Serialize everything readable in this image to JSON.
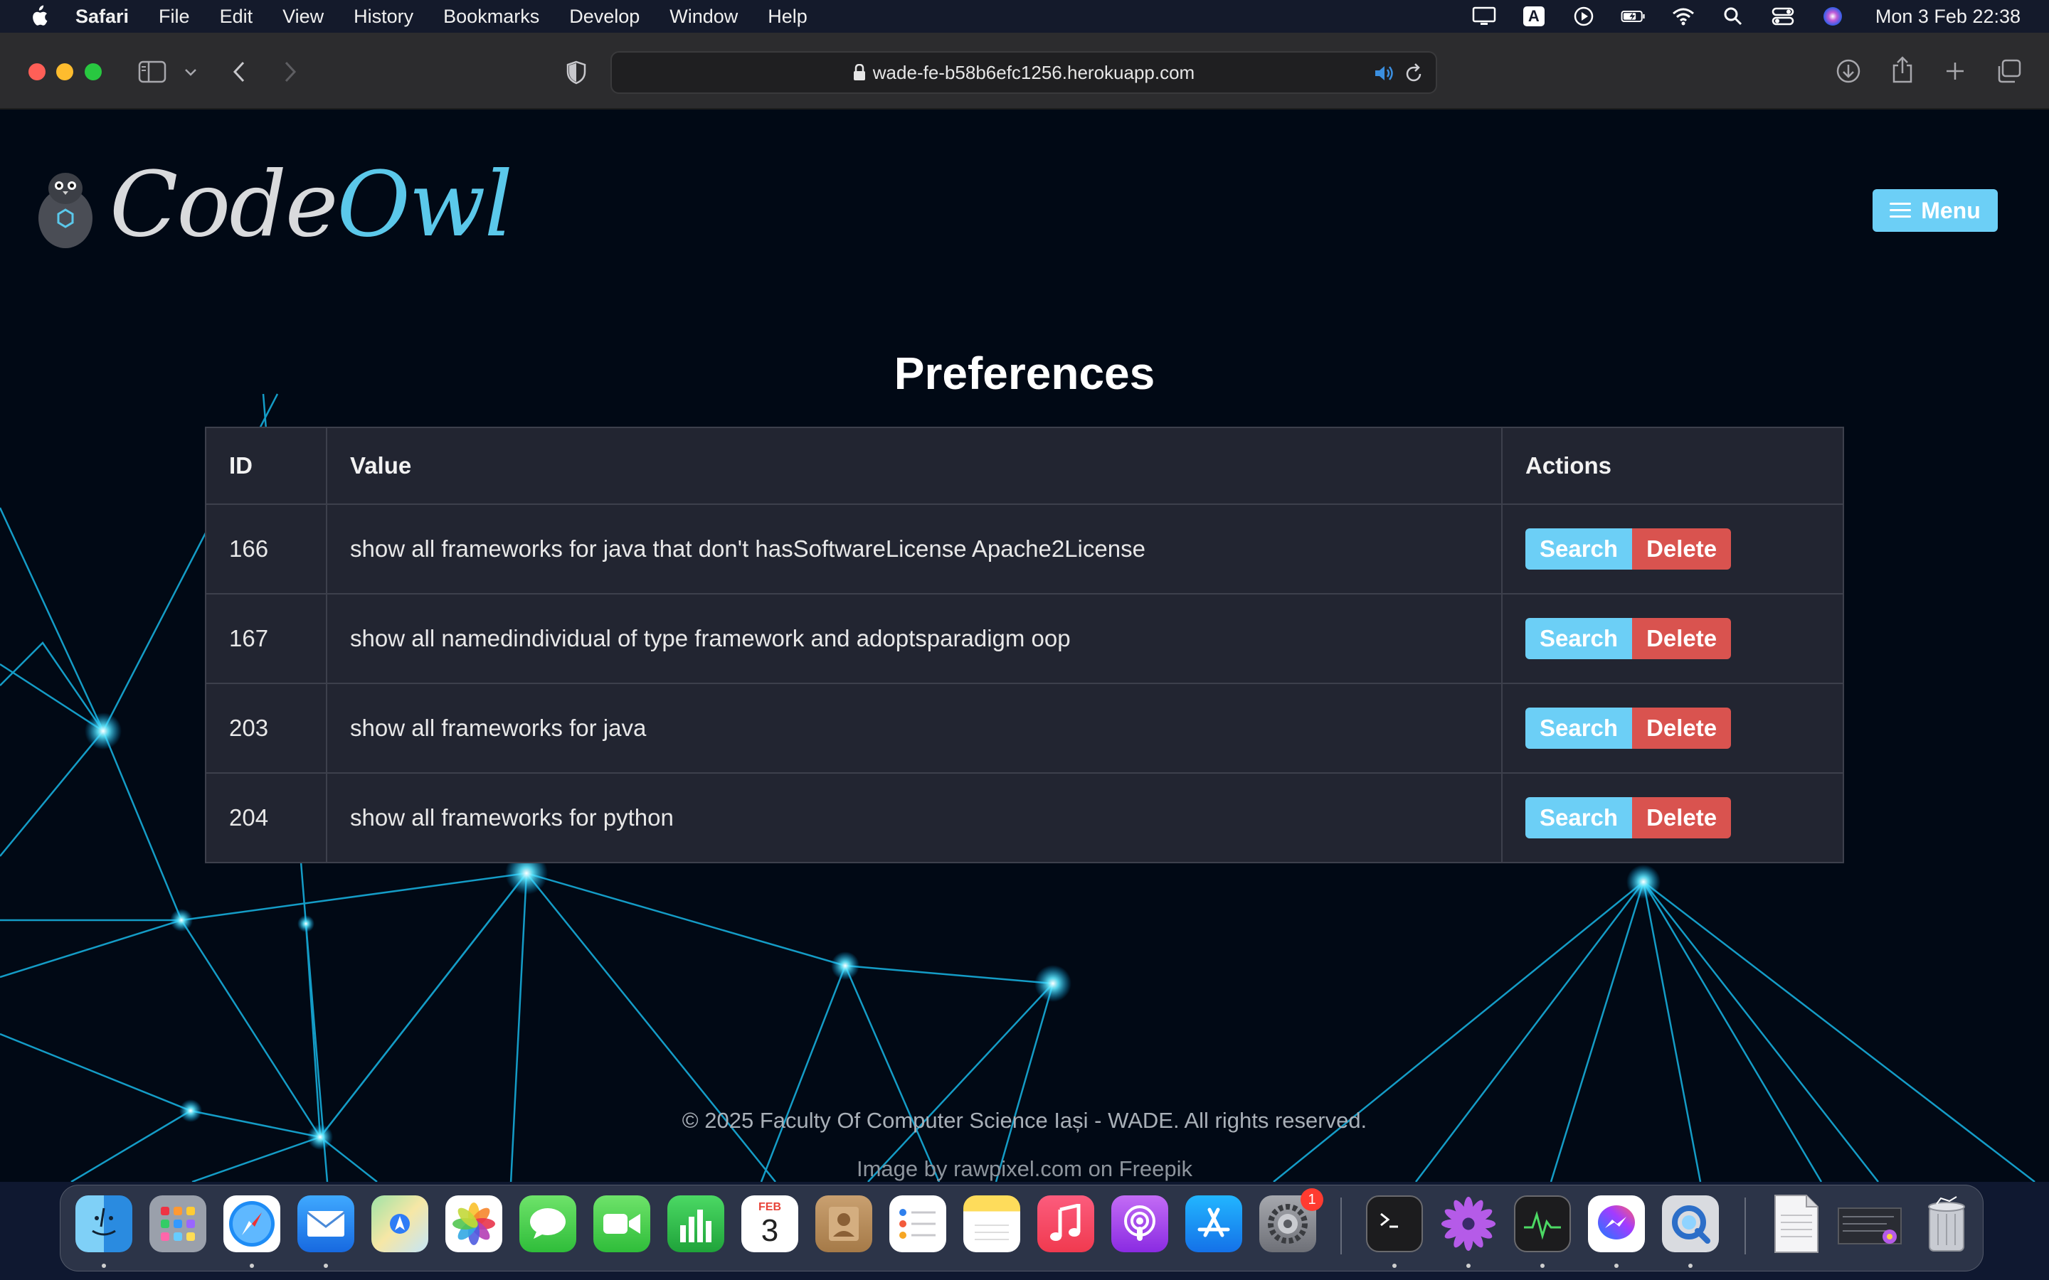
{
  "menubar": {
    "app_name": "Safari",
    "items": [
      "File",
      "Edit",
      "View",
      "History",
      "Bookmarks",
      "Develop",
      "Window",
      "Help"
    ],
    "clock": "Mon 3 Feb  22:38",
    "input_source": "A"
  },
  "browser": {
    "url": "wade-fe-b58b6efc1256.herokuapp.com"
  },
  "site": {
    "logo_code": "Code",
    "logo_owl": "Owl",
    "menu_label": "Menu",
    "page_title": "Preferences",
    "table": {
      "headers": [
        "ID",
        "Value",
        "Actions"
      ],
      "rows": [
        {
          "id": "166",
          "value": "show all frameworks for java that don't hasSoftwareLicense Apache2License"
        },
        {
          "id": "167",
          "value": "show all namedindividual of type framework and adoptsparadigm oop"
        },
        {
          "id": "203",
          "value": "show all frameworks for java"
        },
        {
          "id": "204",
          "value": "show all frameworks for python"
        }
      ],
      "search_label": "Search",
      "delete_label": "Delete"
    },
    "footer_copyright": "© 2025 Faculty Of Computer Science Iași - WADE. All rights reserved.",
    "footer_credit": "Image by rawpixel.com on Freepik"
  },
  "dock": {
    "apps": [
      "finder-icon",
      "launchpad-icon",
      "safari-icon",
      "mail-icon",
      "maps-icon",
      "photos-icon",
      "messages-icon",
      "facetime-icon",
      "numbers-icon",
      "calendar-icon",
      "contacts-icon",
      "reminders-icon",
      "notes-icon",
      "music-icon",
      "podcasts-icon",
      "app-store-icon",
      "system-settings-icon",
      "terminal-icon",
      "flower-app-icon",
      "activity-monitor-icon",
      "messenger-icon",
      "quicktime-icon",
      "html-file-icon",
      "screenshot-thumbnail-icon",
      "trash-icon"
    ],
    "calendar_month": "FEB",
    "calendar_day": "3",
    "settings_badge": "1"
  },
  "colors": {
    "accent": "#6ccff6",
    "danger": "#d9534f",
    "page_bg": "#010915",
    "table_bg": "#222531"
  }
}
